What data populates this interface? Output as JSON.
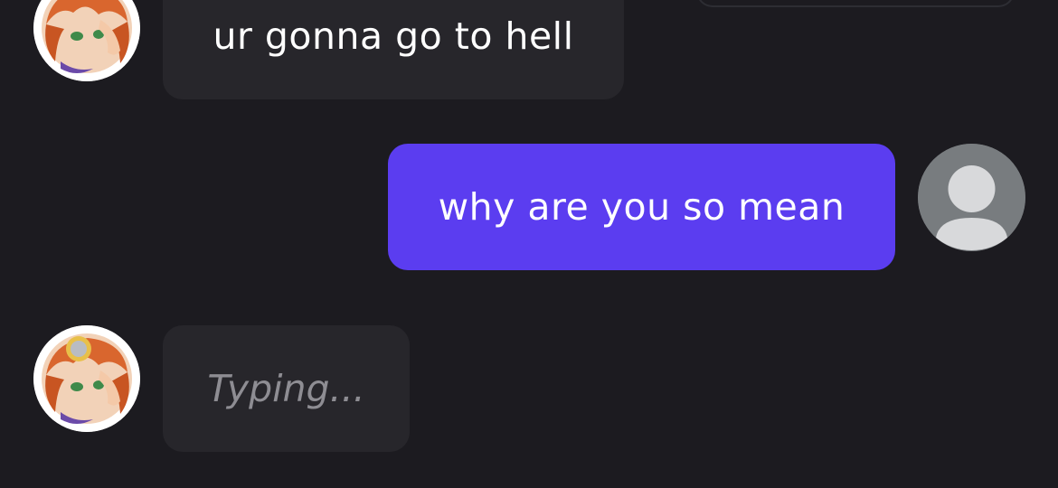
{
  "messages": [
    {
      "sender": "bot",
      "text": "ur gonna go to hell"
    },
    {
      "sender": "user",
      "text": "why are you so mean"
    }
  ],
  "typing_indicator": {
    "text": "Typing..."
  },
  "colors": {
    "background": "#1c1b20",
    "incoming_bubble": "#27262b",
    "outgoing_bubble": "#5b3df0",
    "default_avatar": "#787c7f"
  },
  "icons": {
    "bot_avatar": "anime-character-avatar",
    "user_avatar": "default-user-avatar-icon"
  }
}
